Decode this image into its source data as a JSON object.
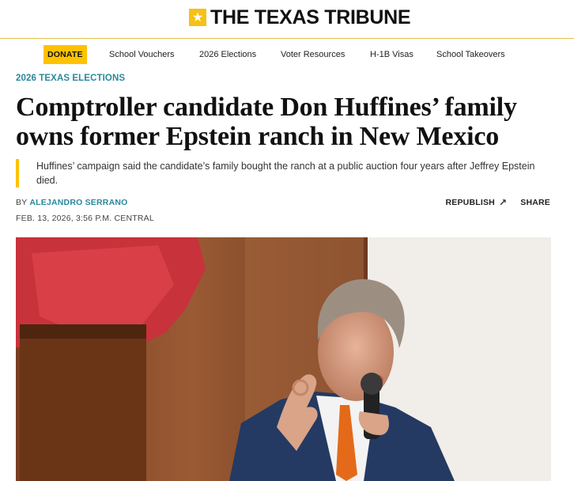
{
  "masthead": {
    "logo_text": "THE TEXAS TRIBUNE",
    "logo_icon": "star-icon",
    "accent": "#ffc200"
  },
  "nav": {
    "donate_label": "DONATE",
    "items": [
      "School Vouchers",
      "2026 Elections",
      "Voter Resources",
      "H-1B Visas",
      "School Takeovers"
    ]
  },
  "article": {
    "kicker": "2026 TEXAS ELECTIONS",
    "headline": "Comptroller candidate Don Huffines’ family owns former Epstein ranch in New Mexico",
    "dek": "Huffines’ campaign said the candidate’s family bought the ranch at a public auction four years after Jeffrey Epstein died.",
    "byline_prefix": "BY",
    "author": "ALEJANDRO SERRANO",
    "timestamp": "FEB. 13, 2026, 3:56 P.M. CENTRAL",
    "republish_label": "REPUBLISH",
    "republish_icon": "arrow-up-right-icon",
    "share_label": "SHARE",
    "kicker_color": "#29889b"
  }
}
